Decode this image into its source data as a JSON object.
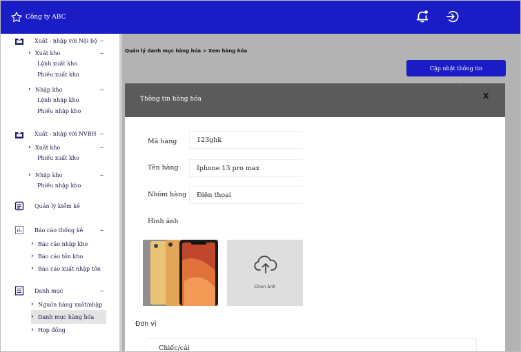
{
  "header": {
    "company_name": "Công ty ABC",
    "bg_color": "#1a1dc6"
  },
  "sidebar": {
    "groups": [
      {
        "label": "Xuất - nhập với Nội bộ",
        "icon": "inbox-icon",
        "subs": [
          {
            "label": "Xuất kho",
            "leaves": [
              "Lệnh xuất kho",
              "Phiếu xuất kho"
            ]
          },
          {
            "label": "Nhập kho",
            "leaves": [
              "Lệnh nhập kho",
              "Phiếu nhập kho"
            ]
          }
        ]
      },
      {
        "label": "Xuất - nhập với NVBH",
        "icon": "inbox-icon",
        "subs": [
          {
            "label": "Xuất kho",
            "leaves": [
              "Phiếu xuất kho"
            ]
          },
          {
            "label": "Nhập kho",
            "leaves": [
              "Phiếu nhập kho"
            ]
          }
        ]
      },
      {
        "label": "Quản lý kiểm kê",
        "icon": "clipboard-icon"
      },
      {
        "label": "Báo cáo thống kê",
        "icon": "bar-chart-icon",
        "items": [
          "Báo cáo nhập kho",
          "Báo cáo tồn kho",
          "Báo cáo xuất nhập tồn"
        ]
      },
      {
        "label": "Danh mục",
        "icon": "list-icon",
        "items": [
          "Nguồn hàng xuất/nhập",
          "Danh mục hàng hóa",
          "Hợp đồng"
        ]
      }
    ]
  },
  "content": {
    "breadcrumb": "Quản lý danh mục hàng hóa  >   Xem hàng hóa",
    "update_button": "Cập nhật thông tin"
  },
  "modal": {
    "title": "Thông tin hàng hóa",
    "close": "X",
    "dots": "...",
    "fields": {
      "code_label": "Mã hàng",
      "code_value": "123ghk",
      "name_label": "Tên hàng",
      "name_value": "Iphone 13 pro max",
      "group_label": "Nhóm hàng",
      "group_value": "Điện thoại",
      "image_label": "Hình ảnh",
      "upload_text": "Chọn ảnh",
      "unit_label": "Đơn vị",
      "unit_value": "Chiếc/cái"
    }
  }
}
